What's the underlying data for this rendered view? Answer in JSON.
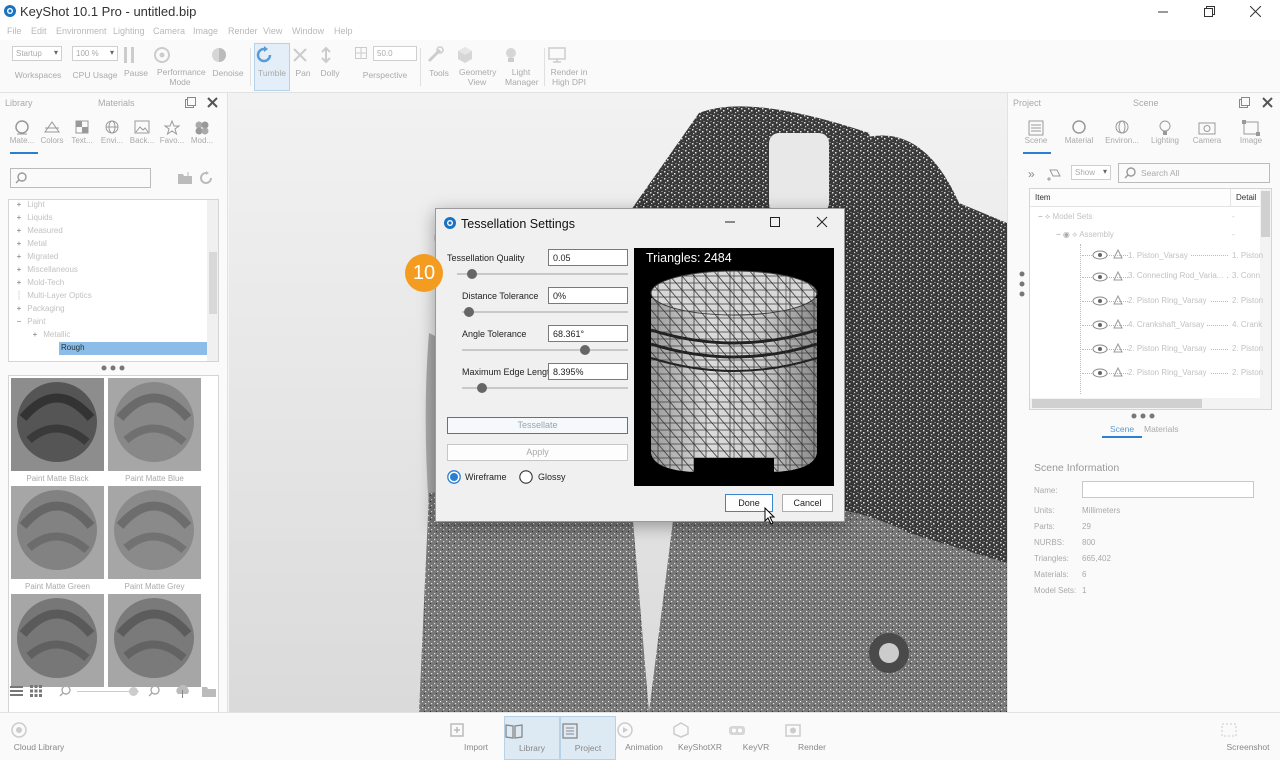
{
  "window": {
    "title": "KeyShot 10.1 Pro  - untitled.bip"
  },
  "menu": [
    "File",
    "Edit",
    "Environment",
    "Lighting",
    "Camera",
    "Image",
    "Render",
    "View",
    "Window",
    "Help"
  ],
  "toolbar": {
    "workspace_value": "Startup",
    "workspaces": "Workspaces",
    "cpu_value": "100 %",
    "cpu_usage": "CPU Usage",
    "pause": "Pause",
    "performance": "Performance Mode",
    "denoise": "Denoise",
    "tumble": "Tumble",
    "pan": "Pan",
    "dolly": "Dolly",
    "persp_value": "50.0",
    "perspective": "Perspective",
    "tools": "Tools",
    "geometry": "Geometry View",
    "light_manager": "Light Manager",
    "render_dpi": "Render in High DPI"
  },
  "library": {
    "title": "Library",
    "subtitle": "Materials",
    "tabs": [
      "Mate...",
      "Colors",
      "Text...",
      "Envi...",
      "Back...",
      "Favo...",
      "Mod..."
    ],
    "search_placeholder": "",
    "tree": [
      {
        "label": "Light",
        "exp": "+",
        "indent": 0
      },
      {
        "label": "Liquids",
        "exp": "+",
        "indent": 0
      },
      {
        "label": "Measured",
        "exp": "+",
        "indent": 0
      },
      {
        "label": "Metal",
        "exp": "+",
        "indent": 0
      },
      {
        "label": "Migrated",
        "exp": "+",
        "indent": 0
      },
      {
        "label": "Miscellaneous",
        "exp": "+",
        "indent": 0
      },
      {
        "label": "Mold-Tech",
        "exp": "+",
        "indent": 0
      },
      {
        "label": "Multi-Layer Optics",
        "exp": "",
        "indent": 0
      },
      {
        "label": "Packaging",
        "exp": "+",
        "indent": 0
      },
      {
        "label": "Paint",
        "exp": "−",
        "indent": 0
      },
      {
        "label": "Metallic",
        "exp": "+",
        "indent": 1
      },
      {
        "label": "Rough",
        "exp": "",
        "indent": 1,
        "selected": true
      }
    ],
    "thumbs": [
      "Paint Matte Black",
      "Paint Matte Blue",
      "Paint Matte Green",
      "Paint Matte Grey",
      "",
      ""
    ]
  },
  "dialog": {
    "title": "Tessellation Settings",
    "step_badge": "10",
    "quality_label": "Tessellation Quality",
    "quality_value": "0.05",
    "quality_pos": 0.09,
    "distance_label": "Distance Tolerance",
    "distance_value": "0%",
    "distance_pos": 0.04,
    "angle_label": "Angle Tolerance",
    "angle_value": "68.361°",
    "angle_pos": 0.74,
    "edge_label": "Maximum Edge Length",
    "edge_value": "8.395%",
    "edge_pos": 0.12,
    "tessellate": "Tessellate",
    "apply": "Apply",
    "wireframe": "Wireframe",
    "glossy": "Glossy",
    "triangles": "Triangles: 2484",
    "done": "Done",
    "cancel": "Cancel"
  },
  "project": {
    "title": "Project",
    "subtitle": "Scene",
    "tabs": [
      "Scene",
      "Material",
      "Environ...",
      "Lighting",
      "Camera",
      "Image"
    ],
    "show": "Show",
    "search_placeholder": "Search All",
    "col_item": "Item",
    "col_detail": "Detail",
    "tree": [
      {
        "label": "Model Sets",
        "detail": "-"
      },
      {
        "label": "Assembly",
        "detail": "-"
      },
      {
        "label": "1. Piston_Varsay",
        "detail": "1. Piston"
      },
      {
        "label": "3. Connecting Rod_Varia...",
        "detail": "3. Conn"
      },
      {
        "label": "2. Piston Ring_Varsay",
        "detail": "2. Piston"
      },
      {
        "label": "4. Crankshaft_Varsay",
        "detail": "4. Crank"
      },
      {
        "label": "2. Piston Ring_Varsay",
        "detail": "2. Piston"
      },
      {
        "label": "2. Piston Ring_Varsay",
        "detail": "2. Piston"
      }
    ],
    "subtabs": [
      "Scene",
      "Materials"
    ],
    "info_title": "Scene Information",
    "info": [
      {
        "k": "Name:",
        "v": ""
      },
      {
        "k": "Units:",
        "v": "Millimeters"
      },
      {
        "k": "Parts:",
        "v": "29"
      },
      {
        "k": "NURBS:",
        "v": "800"
      },
      {
        "k": "Triangles:",
        "v": "665,402"
      },
      {
        "k": "Materials:",
        "v": "6"
      },
      {
        "k": "Model Sets:",
        "v": "1"
      }
    ]
  },
  "bottom": {
    "cloud": "Cloud Library",
    "import": "Import",
    "library": "Library",
    "project": "Project",
    "animation": "Animation",
    "xr": "KeyShotXR",
    "vr": "KeyVR",
    "render": "Render",
    "screenshot": "Screenshot"
  },
  "colors": {
    "accent": "#2a7fd0",
    "badge": "#f39c1f"
  }
}
